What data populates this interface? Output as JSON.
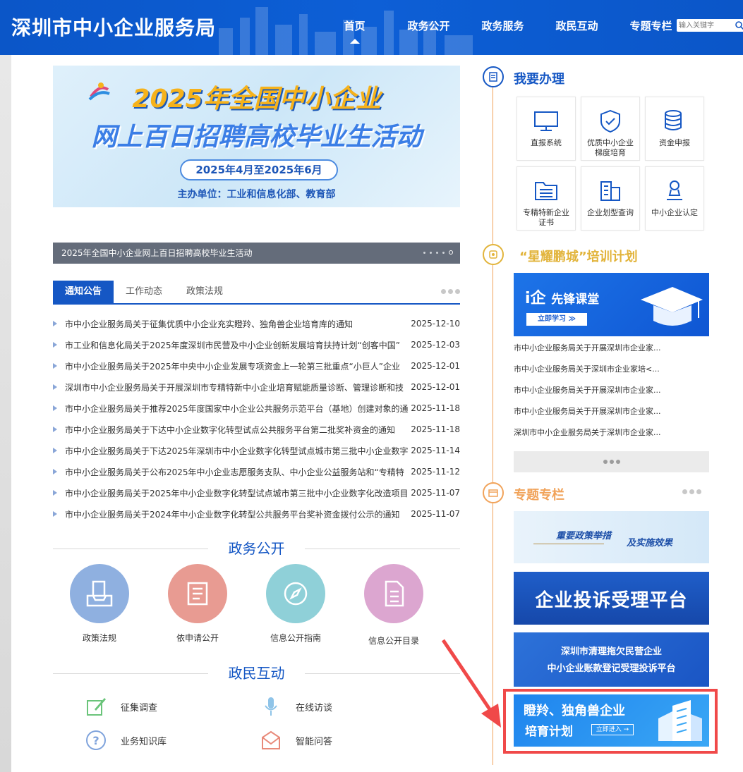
{
  "header": {
    "site_title": "深圳市中小企业服务局",
    "nav": [
      "首页",
      "政务公开",
      "政务服务",
      "政民互动",
      "专题专栏"
    ],
    "active_nav": "首页",
    "search_placeholder": "输入关键字"
  },
  "banner": {
    "line1": "2025年全国中小企业",
    "line2": "网上百日招聘高校毕业生活动",
    "date": "2025年4月至2025年6月",
    "organizer": "主办单位：工业和信息化部、教育部",
    "caption": "2025年全国中小企业网上百日招聘高校毕业生活动"
  },
  "tabs": [
    "通知公告",
    "工作动态",
    "政策法规"
  ],
  "news": [
    {
      "title": "市中小企业服务局关于征集优质中小企业充实瞪羚、独角兽企业培育库的通知",
      "date": "2025-12-10"
    },
    {
      "title": "市工业和信息化局关于2025年度深圳市民营及中小企业创新发展培育扶持计划“创客中国”",
      "date": "2025-12-03"
    },
    {
      "title": "市中小企业服务局关于2025年中央中小企业发展专项资金上一轮第三批重点“小巨人”企业",
      "date": "2025-12-01"
    },
    {
      "title": "深圳市中小企业服务局关于开展深圳市专精特新中小企业培育赋能质量诊断、管理诊断和技",
      "date": "2025-12-01"
    },
    {
      "title": "市中小企业服务局关于推荐2025年度国家中小企业公共服务示范平台（基地）创建对象的通",
      "date": "2025-11-18"
    },
    {
      "title": "市中小企业服务局关于下达中小企业数字化转型试点公共服务平台第二批奖补资金的通知",
      "date": "2025-11-18"
    },
    {
      "title": "市中小企业服务局关于下达2025年深圳市中小企业数字化转型试点城市第三批中小企业数字",
      "date": "2025-11-14"
    },
    {
      "title": "市中小企业服务局关于公布2025年中小企业志愿服务支队、中小企业公益服务站和“专精特",
      "date": "2025-11-12"
    },
    {
      "title": "市中小企业服务局关于2025年中小企业数字化转型试点城市第三批中小企业数字化改造项目",
      "date": "2025-11-07"
    },
    {
      "title": "市中小企业服务局关于2024年中小企业数字化转型公共服务平台奖补资金拨付公示的通知",
      "date": "2025-11-07"
    }
  ],
  "gov_open": {
    "title": "政务公开",
    "items": [
      "政策法规",
      "依申请公开",
      "信息公开指南",
      "信息公开目录"
    ]
  },
  "interaction": {
    "title": "政民互动",
    "items": [
      "征集调查",
      "在线访谈",
      "业务知识库",
      "智能问答"
    ]
  },
  "handle": {
    "title": "我要办理",
    "items": [
      "直报系统",
      "优质中小企业梯度培育",
      "资金申报",
      "专精特新企业证书",
      "企业划型查询",
      "中小企业认定"
    ]
  },
  "training": {
    "title": "“星耀鹏城”培训计划",
    "banner_main": "i企",
    "banner_sub": "先锋课堂",
    "banner_btn": "立即学习 ≫",
    "items": [
      "市中小企业服务局关于开展深圳市企业家...",
      "市中小企业服务局关于深圳市企业家培<...",
      "市中小企业服务局关于开展深圳市企业家...",
      "市中小企业服务局关于开展深圳市企业家...",
      "深圳市中小企业服务局关于深圳市企业家..."
    ]
  },
  "topics": {
    "title": "专题专栏",
    "t1a": "重要政策举措",
    "t1b": "及实施效果",
    "t2": "企业投诉受理平台",
    "t3a": "深圳市清理拖欠民营企业",
    "t3b": "中小企业账款登记受理投诉平台",
    "t4a": "瞪羚、独角兽企业",
    "t4b": "培育计划",
    "t4btn": "立即进入 →"
  },
  "colors": {
    "primary": "#1557c4",
    "accent_orange": "#f1a35a",
    "highlight_red": "#f04949"
  }
}
